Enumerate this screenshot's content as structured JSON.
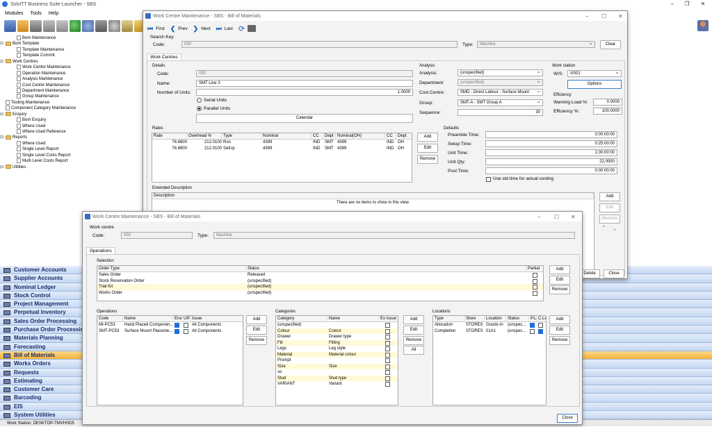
{
  "app": {
    "title": "SolviTT Business Suite Launcher - SBS"
  },
  "menu": [
    "Modules",
    "Tools",
    "Help"
  ],
  "tree": [
    {
      "label": "Bom Maintenance",
      "level": 1,
      "type": "doc"
    },
    {
      "label": "Bom Template",
      "level": 0,
      "type": "folder"
    },
    {
      "label": "Template Maintenance",
      "level": 1,
      "type": "doc"
    },
    {
      "label": "Template Commit",
      "level": 1,
      "type": "doc"
    },
    {
      "label": "Work Centres",
      "level": 0,
      "type": "folder"
    },
    {
      "label": "Work Centre Maintenance",
      "level": 1,
      "type": "doc"
    },
    {
      "label": "Operation Maintenance",
      "level": 1,
      "type": "doc"
    },
    {
      "label": "Analysis Maintenance",
      "level": 1,
      "type": "doc"
    },
    {
      "label": "Cost Centre Maintenance",
      "level": 1,
      "type": "doc"
    },
    {
      "label": "Department Maintenance",
      "level": 1,
      "type": "doc"
    },
    {
      "label": "Group Maintenance",
      "level": 1,
      "type": "doc"
    },
    {
      "label": "Tooling Maintenance",
      "level": 0,
      "type": "doc"
    },
    {
      "label": "Component Category Maintenance",
      "level": 0,
      "type": "doc"
    },
    {
      "label": "Enquiry",
      "level": 0,
      "type": "folder"
    },
    {
      "label": "Bom Enquiry",
      "level": 1,
      "type": "doc"
    },
    {
      "label": "Where Used",
      "level": 1,
      "type": "doc"
    },
    {
      "label": "Where Used Reference",
      "level": 1,
      "type": "doc"
    },
    {
      "label": "Reports",
      "level": 0,
      "type": "folder"
    },
    {
      "label": "Where Used",
      "level": 1,
      "type": "doc"
    },
    {
      "label": "Single Level Report",
      "level": 1,
      "type": "doc"
    },
    {
      "label": "Single Level Costs Report",
      "level": 1,
      "type": "doc"
    },
    {
      "label": "Multi Level Costs Report",
      "level": 1,
      "type": "doc"
    },
    {
      "label": "Utilities",
      "level": 0,
      "type": "folder"
    }
  ],
  "nav": [
    {
      "label": "Customer Accounts",
      "selected": false
    },
    {
      "label": "Supplier Accounts",
      "selected": false
    },
    {
      "label": "Nominal Ledger",
      "selected": false
    },
    {
      "label": "Stock Control",
      "selected": false
    },
    {
      "label": "Project Management",
      "selected": false
    },
    {
      "label": "Perpetual Inventory",
      "selected": false
    },
    {
      "label": "Sales Order Processing",
      "selected": false
    },
    {
      "label": "Purchase Order Processing",
      "selected": false
    },
    {
      "label": "Materials Planning",
      "selected": false
    },
    {
      "label": "Forecasting",
      "selected": false
    },
    {
      "label": "Bill of Materials",
      "selected": true
    },
    {
      "label": "Works Orders",
      "selected": false
    },
    {
      "label": "Requests",
      "selected": false
    },
    {
      "label": "Estimating",
      "selected": false
    },
    {
      "label": "Customer Care",
      "selected": false
    },
    {
      "label": "Barcoding",
      "selected": false
    },
    {
      "label": "EIS",
      "selected": false
    },
    {
      "label": "System Utilities",
      "selected": false
    }
  ],
  "status": "Work Station: DESKTOP-TMVHSD5",
  "win1": {
    "title": "Work Centre Maintenance - SBS - Bill of Materials",
    "nav": {
      "first": "First",
      "prev": "Prev",
      "next": "Next",
      "last": "Last"
    },
    "search_key": "Search Key",
    "code_label": "Code:",
    "code": "050",
    "type_label": "Type:",
    "type": "Machine",
    "clear": "Clear",
    "tab": "Work Centres",
    "details": {
      "title": "Details",
      "code_label": "Code:",
      "code": "050",
      "name_label": "Name:",
      "name": "SMT Line 3",
      "units_label": "Number of Units:",
      "units": "1.0000",
      "serial": "Serial Units",
      "parallel": "Parallel Units",
      "calendar": "Calendar"
    },
    "analysis": {
      "title": "Analysis",
      "analysis_label": "Analysis:",
      "analysis": "(unspecified)",
      "dept_label": "Department:",
      "dept": "(unspecified)",
      "cc_label": "Cost Centre:",
      "cc": "SMD - Direct Labour - Surface Mount",
      "group_label": "Group:",
      "group": "SMT-A - SMT Group A",
      "seq_label": "Sequence:",
      "seq": "30"
    },
    "workstation": {
      "title": "Work station",
      "ws_label": "W/S:",
      "ws": "AS01",
      "options": "Options"
    },
    "efficiency": {
      "title": "Efficiency",
      "warn_label": "Warning Load %:",
      "warn": "0.0000",
      "eff_label": "Efficiency %:",
      "eff": "100.0000"
    },
    "rates": {
      "title": "Rates",
      "headers": [
        "Rate",
        "Overhead %",
        "Type",
        "Nominal",
        "CC",
        "Dept",
        "Nominal(OH)",
        "CC",
        "Dept"
      ],
      "rows": [
        [
          "76.8600",
          "212.0100",
          "Run",
          "4399",
          "IND",
          "SMT",
          "4399",
          "IND",
          "OH"
        ],
        [
          "76.8600",
          "212.0100",
          "SetUp",
          "4399",
          "IND",
          "SMT",
          "4399",
          "IND",
          "OH"
        ]
      ],
      "add": "Add",
      "edit": "Edit",
      "remove": "Remove"
    },
    "defaults": {
      "title": "Defaults",
      "preamble_label": "Preamble Time:",
      "preamble": "0:00:00:00",
      "setup_label": "Setup Time:",
      "setup": "0:25:00:00",
      "unit_label": "Unit Time:",
      "unit": "1:00:00:00",
      "qty_label": "Unit Qty:",
      "qty": "22.0000",
      "post_label": "Post Time:",
      "post": "0:00:00:00",
      "std": "Use std time for actual costing"
    },
    "ext": {
      "title": "Extended Description",
      "header": "Description",
      "empty": "There are no items to show in this view.",
      "add": "Add",
      "edit": "Edit",
      "remove": "Remove"
    },
    "delete": "Delete",
    "close": "Close"
  },
  "win2": {
    "title": "Work Centre Maintenance - SBS - Bill of Materials",
    "wc": "Work centre",
    "code_label": "Code:",
    "code": "050",
    "type_label": "Type:",
    "type": "Machine",
    "tab": "Operations",
    "selection": {
      "title": "Selection",
      "headers": [
        "Order Type",
        "Status",
        "Partial"
      ],
      "rows": [
        [
          "Sales Order",
          "Released"
        ],
        [
          "Stock Reservation Order",
          "(unspecified)"
        ],
        [
          "Trial Kit",
          "(unspecified)"
        ],
        [
          "Works Order",
          "(unspecified)"
        ]
      ],
      "add": "Add",
      "edit": "Edit",
      "remove": "Remove"
    },
    "operations": {
      "title": "Operations",
      "headers": [
        "Code",
        "Name",
        "Ena",
        "U/P",
        "Issue"
      ],
      "rows": [
        [
          "MI-PC53",
          "Hand Placed Componen...",
          "All Components"
        ],
        [
          "SMT-PC53",
          "Surface Mount Placeme...",
          "All Components"
        ]
      ],
      "add": "Add",
      "edit": "Edit",
      "remove": "Remove"
    },
    "categories": {
      "title": "Categories",
      "headers": [
        "Category",
        "Name",
        "Ex Issue"
      ],
      "rows": [
        [
          "(unspecified)",
          ""
        ],
        [
          "Colour",
          "Colour"
        ],
        [
          "Drawer",
          "Drawer type"
        ],
        [
          "Fill",
          "Filling"
        ],
        [
          "Legs",
          "Leg style"
        ],
        [
          "Material",
          "Material colour"
        ],
        [
          "Prompt",
          ""
        ],
        [
          "Size",
          "Size"
        ],
        [
          "so",
          ""
        ],
        [
          "Stud",
          "Stud type"
        ],
        [
          "VARIANT",
          "Variant"
        ]
      ],
      "add": "Add",
      "edit": "Edit",
      "remove": "Remove",
      "all": "All"
    },
    "locations": {
      "title": "Locations",
      "headers": [
        "Type",
        "Store",
        "Location",
        "Status",
        "P.L",
        "C.La"
      ],
      "rows": [
        [
          "Allocation",
          "STORES",
          "Goods-In",
          "(unspec..."
        ],
        [
          "Completion",
          "STORES",
          "01A1",
          "(unspec..."
        ]
      ],
      "add": "Add",
      "edit": "Edit",
      "remove": "Remove"
    },
    "close": "Close"
  }
}
